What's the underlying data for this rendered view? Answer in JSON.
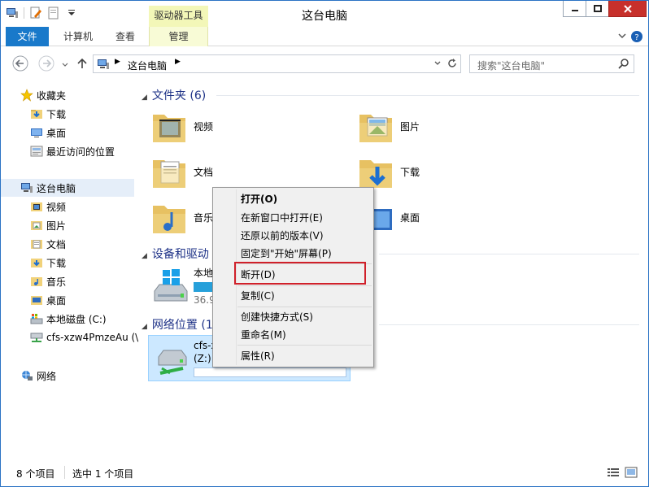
{
  "window": {
    "title": "这台电脑",
    "context_tab_group": "驱动器工具"
  },
  "ribbon": {
    "tabs": [
      "文件",
      "计算机",
      "查看",
      "管理"
    ]
  },
  "address": {
    "path": "这台电脑",
    "search_placeholder": "搜索\"这台电脑\""
  },
  "nav": {
    "favorites": "收藏夹",
    "fav_items": [
      "下载",
      "桌面",
      "最近访问的位置"
    ],
    "this_pc": "这台电脑",
    "pc_items": [
      "视频",
      "图片",
      "文档",
      "下载",
      "音乐",
      "桌面",
      "本地磁盘 (C:)",
      "cfs-xzw4PmzeAu (\\"
    ],
    "network": "网络"
  },
  "content": {
    "folders_header": "文件夹 (6)",
    "folders": [
      "视频",
      "图片",
      "文档",
      "下载",
      "音乐",
      "桌面"
    ],
    "devices_header": "设备和驱动",
    "local_disk_label": "本地",
    "local_disk_size": "36.9",
    "network_header": "网络位置 (1",
    "net_drive_name": "cfs-x",
    "net_drive_letter": "(Z:)"
  },
  "context_menu": {
    "items": [
      "打开(O)",
      "在新窗口中打开(E)",
      "还原以前的版本(V)",
      "固定到\"开始\"屏幕(P)",
      "断开(D)",
      "复制(C)",
      "创建快捷方式(S)",
      "重命名(M)",
      "属性(R)"
    ]
  },
  "status": {
    "count": "8 个项目",
    "selected": "选中 1 个项目"
  },
  "colors": {
    "accent": "#1979ca",
    "context_tab": "#f3f7b8",
    "close": "#c7302b",
    "highlight_box": "#d0202a",
    "header_text": "#1e3287"
  }
}
